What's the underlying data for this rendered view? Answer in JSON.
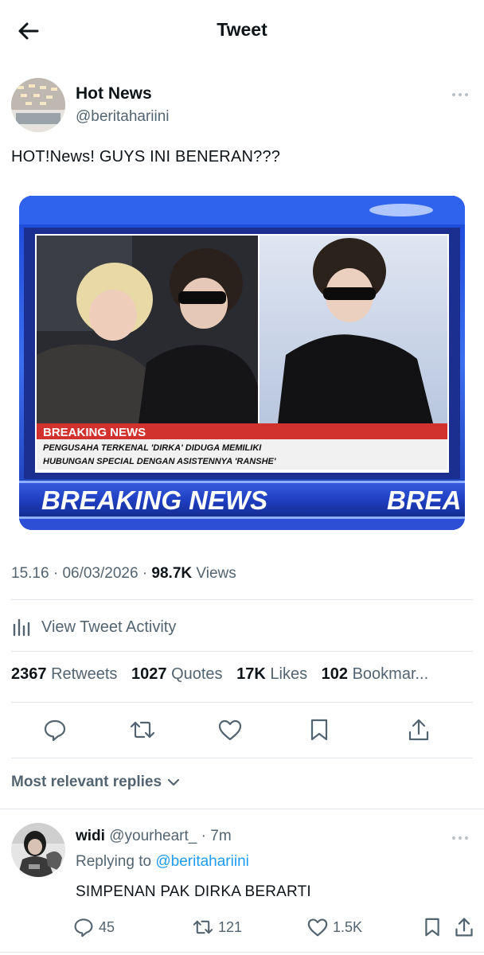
{
  "topbar": {
    "title": "Tweet"
  },
  "tweet": {
    "author_name": "Hot News",
    "author_handle": "@beritahariini",
    "text": "HOT!News! GUYS INI BENERAN???",
    "media": {
      "ticker_heading": "BREAKING NEWS",
      "ticker_line1": "PENGUSAHA TERKENAL 'DIRKA' DIDUGA MEMILIKI",
      "ticker_line2": "HUBUNGAN SPECIAL DENGAN ASISTENNYA 'RANSHE'",
      "banner_text": "BREAKING NEWS",
      "banner_repeat": "BREA"
    },
    "time": "15.16",
    "date": "06/03/2026",
    "views_count": "98.7K",
    "views_label": "Views",
    "activity_label": "View Tweet Activity",
    "stats": {
      "retweets_count": "2367",
      "retweets_label": "Retweets",
      "quotes_count": "1027",
      "quotes_label": "Quotes",
      "likes_count": "17K",
      "likes_label": "Likes",
      "bookmarks_count": "102",
      "bookmarks_label": "Bookmar..."
    }
  },
  "replies_sort_label": "Most relevant replies",
  "reply": {
    "name": "widi",
    "handle": "@yourheart_",
    "age": "7m",
    "replying_to_label": "Replying to",
    "replying_to_handle": "@beritahariini",
    "text": "SIMPENAN PAK DIRKA BERARTI",
    "reply_count": "45",
    "retweet_count": "121",
    "like_count": "1.5K"
  },
  "colors": {
    "accent": "#1d9bf0",
    "muted": "#536471",
    "text": "#0f1419",
    "divider": "#e1e6ea",
    "breaking_red": "#d2322d",
    "banner_blue": "#1f3fc2"
  },
  "icons": [
    "arrow-left-icon",
    "more-icon",
    "bar-chart-icon",
    "reply-icon",
    "retweet-icon",
    "heart-icon",
    "bookmark-icon",
    "share-icon",
    "chevron-down-icon"
  ]
}
